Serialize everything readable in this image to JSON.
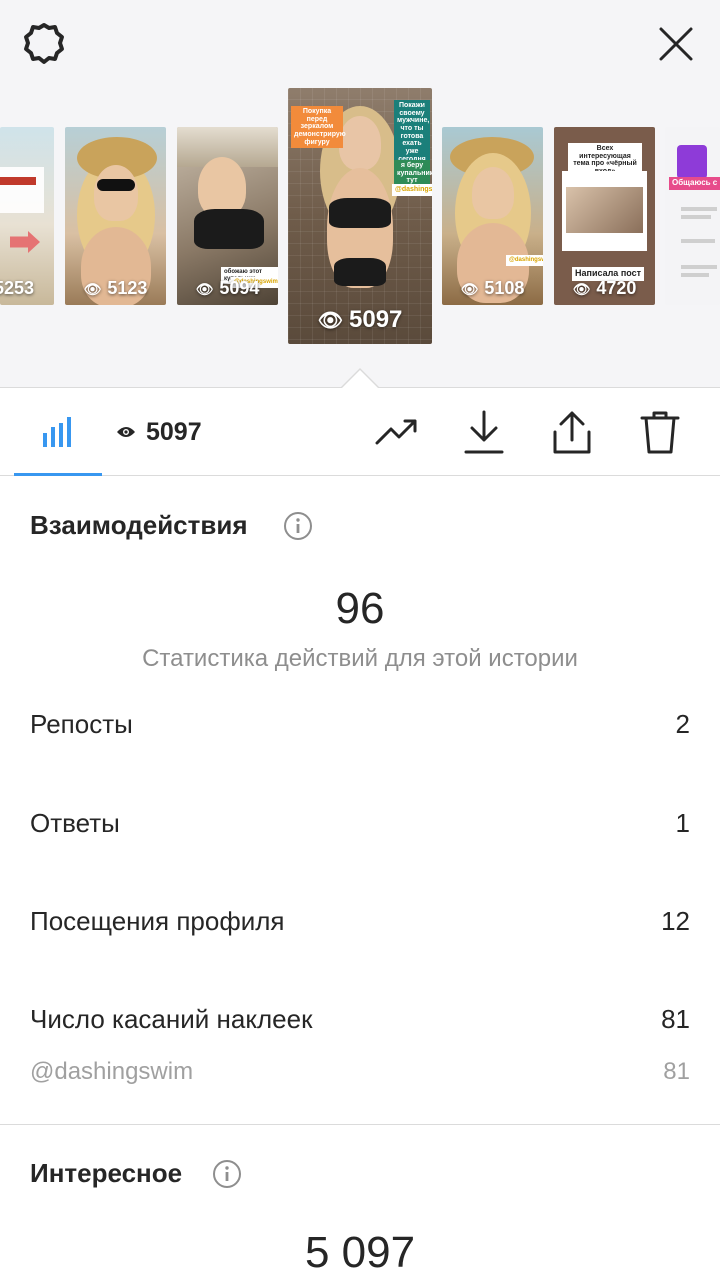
{
  "header": {
    "settings_icon": "gear-icon",
    "close_icon": "close-icon"
  },
  "stories": [
    {
      "views": "5253"
    },
    {
      "views": "5123"
    },
    {
      "views": "5094"
    },
    {
      "views": "5097",
      "selected": true
    },
    {
      "views": "5108"
    },
    {
      "views": "4720"
    }
  ],
  "story_texts": {
    "s4_a": "Покупка перед зеркалом демонстрирую фигуру",
    "s4_b": "Покажи своему мужчине, что ты готова ехать уже сегодня",
    "s4_c": "я беру купальники тут",
    "s4_d": "@dashingswim",
    "s3_a": "обожаю этот купальник",
    "s3_b": "@dashingswim",
    "s5_a": "@dashingswim",
    "s6_a": "Всех интересующая тема про «чёрный вход»",
    "s6_b": "Написала пост",
    "s7_a": "Общаюсь с"
  },
  "toolbar": {
    "viewers_count": "5097"
  },
  "interactions": {
    "title": "Взаимодействия",
    "total": "96",
    "subtitle": "Статистика действий для этой истории",
    "rows": [
      {
        "label": "Репосты",
        "value": "2"
      },
      {
        "label": "Ответы",
        "value": "1"
      },
      {
        "label": "Посещения профиля",
        "value": "12"
      },
      {
        "label": "Число касаний наклеек",
        "value": "81"
      }
    ],
    "sticker": {
      "label": "@dashingswim",
      "value": "81"
    }
  },
  "discovery": {
    "title": "Интересное",
    "total": "5 097"
  },
  "colors": {
    "accent": "#3897f0",
    "text": "#262626",
    "muted": "#8e8e8e"
  }
}
